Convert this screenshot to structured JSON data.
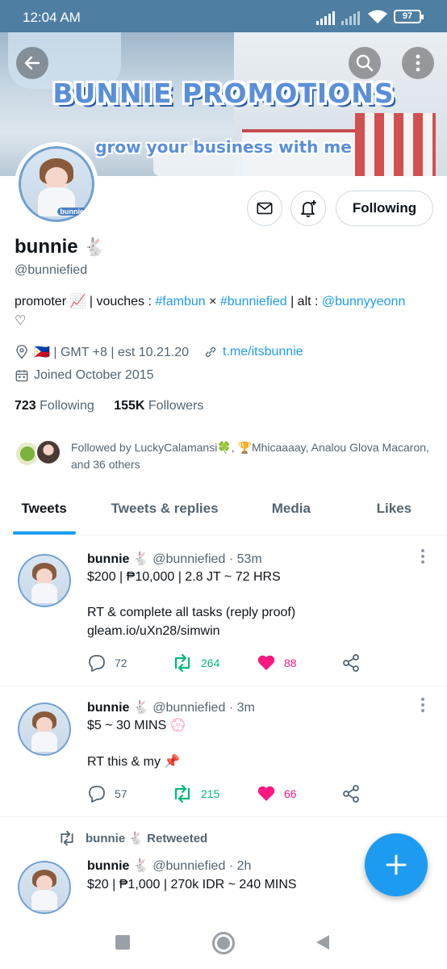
{
  "status_bar": {
    "time": "12:04 AM",
    "battery": "97"
  },
  "banner": {
    "title": "BUNNIE PROMOTIONS",
    "subtitle": "grow your business with me",
    "avatar_tag": "bunnie"
  },
  "profile": {
    "name": "bunnie",
    "name_emoji": "🐇",
    "handle": "@bunniefied",
    "follow_button": "Following",
    "bio": {
      "prefix": "promoter 📈 | vouches : ",
      "tag1": "#fambun",
      "sep": " × ",
      "tag2": "#bunniefied",
      "alt": " | alt : ",
      "alt_handle": "@bunnyyeonn",
      "suffix": "♡"
    },
    "location": "🇵🇭 | GMT +8 | est 10.21.20",
    "website": "t.me/itsbunnie",
    "joined": "Joined October 2015",
    "following_count": "723",
    "following_label": "Following",
    "followers_count": "155K",
    "followers_label": "Followers",
    "followed_by": "Followed by LuckyCalamansi🍀, 🏆Mhicaaaay, Analou Glova Macaron, and 36 others"
  },
  "tabs": [
    "Tweets",
    "Tweets & replies",
    "Media",
    "Likes"
  ],
  "tweets": [
    {
      "name": "bunnie",
      "emoji": "🐇",
      "handle": "@bunniefied",
      "time": "· 53m",
      "line1": "$200 | ₱10,000 | 2.8 JT ~ 72 HRS",
      "line2": "RT & complete all tasks (reply proof)",
      "link": "gleam.io/uXn28/simwin",
      "replies": "72",
      "retweets": "264",
      "likes": "88"
    },
    {
      "name": "bunnie",
      "emoji": "🐇",
      "handle": "@bunniefied",
      "time": "· 3m",
      "line1": "$5 ~ 30 MINS 💮",
      "line2": "RT this & my 📌",
      "replies": "57",
      "retweets": "215",
      "likes": "66"
    },
    {
      "retweeted_by": "bunnie 🐇 Retweeted",
      "name": "bunnie",
      "emoji": "🐇",
      "handle": "@bunniefied",
      "time": "· 2h",
      "line1": "$20 | ₱1,000 | 270k IDR ~ 240 MINS"
    }
  ],
  "colors": {
    "accent": "#1d9bf0",
    "retweet": "#00ba7c",
    "like": "#f91880",
    "muted": "#536471"
  }
}
